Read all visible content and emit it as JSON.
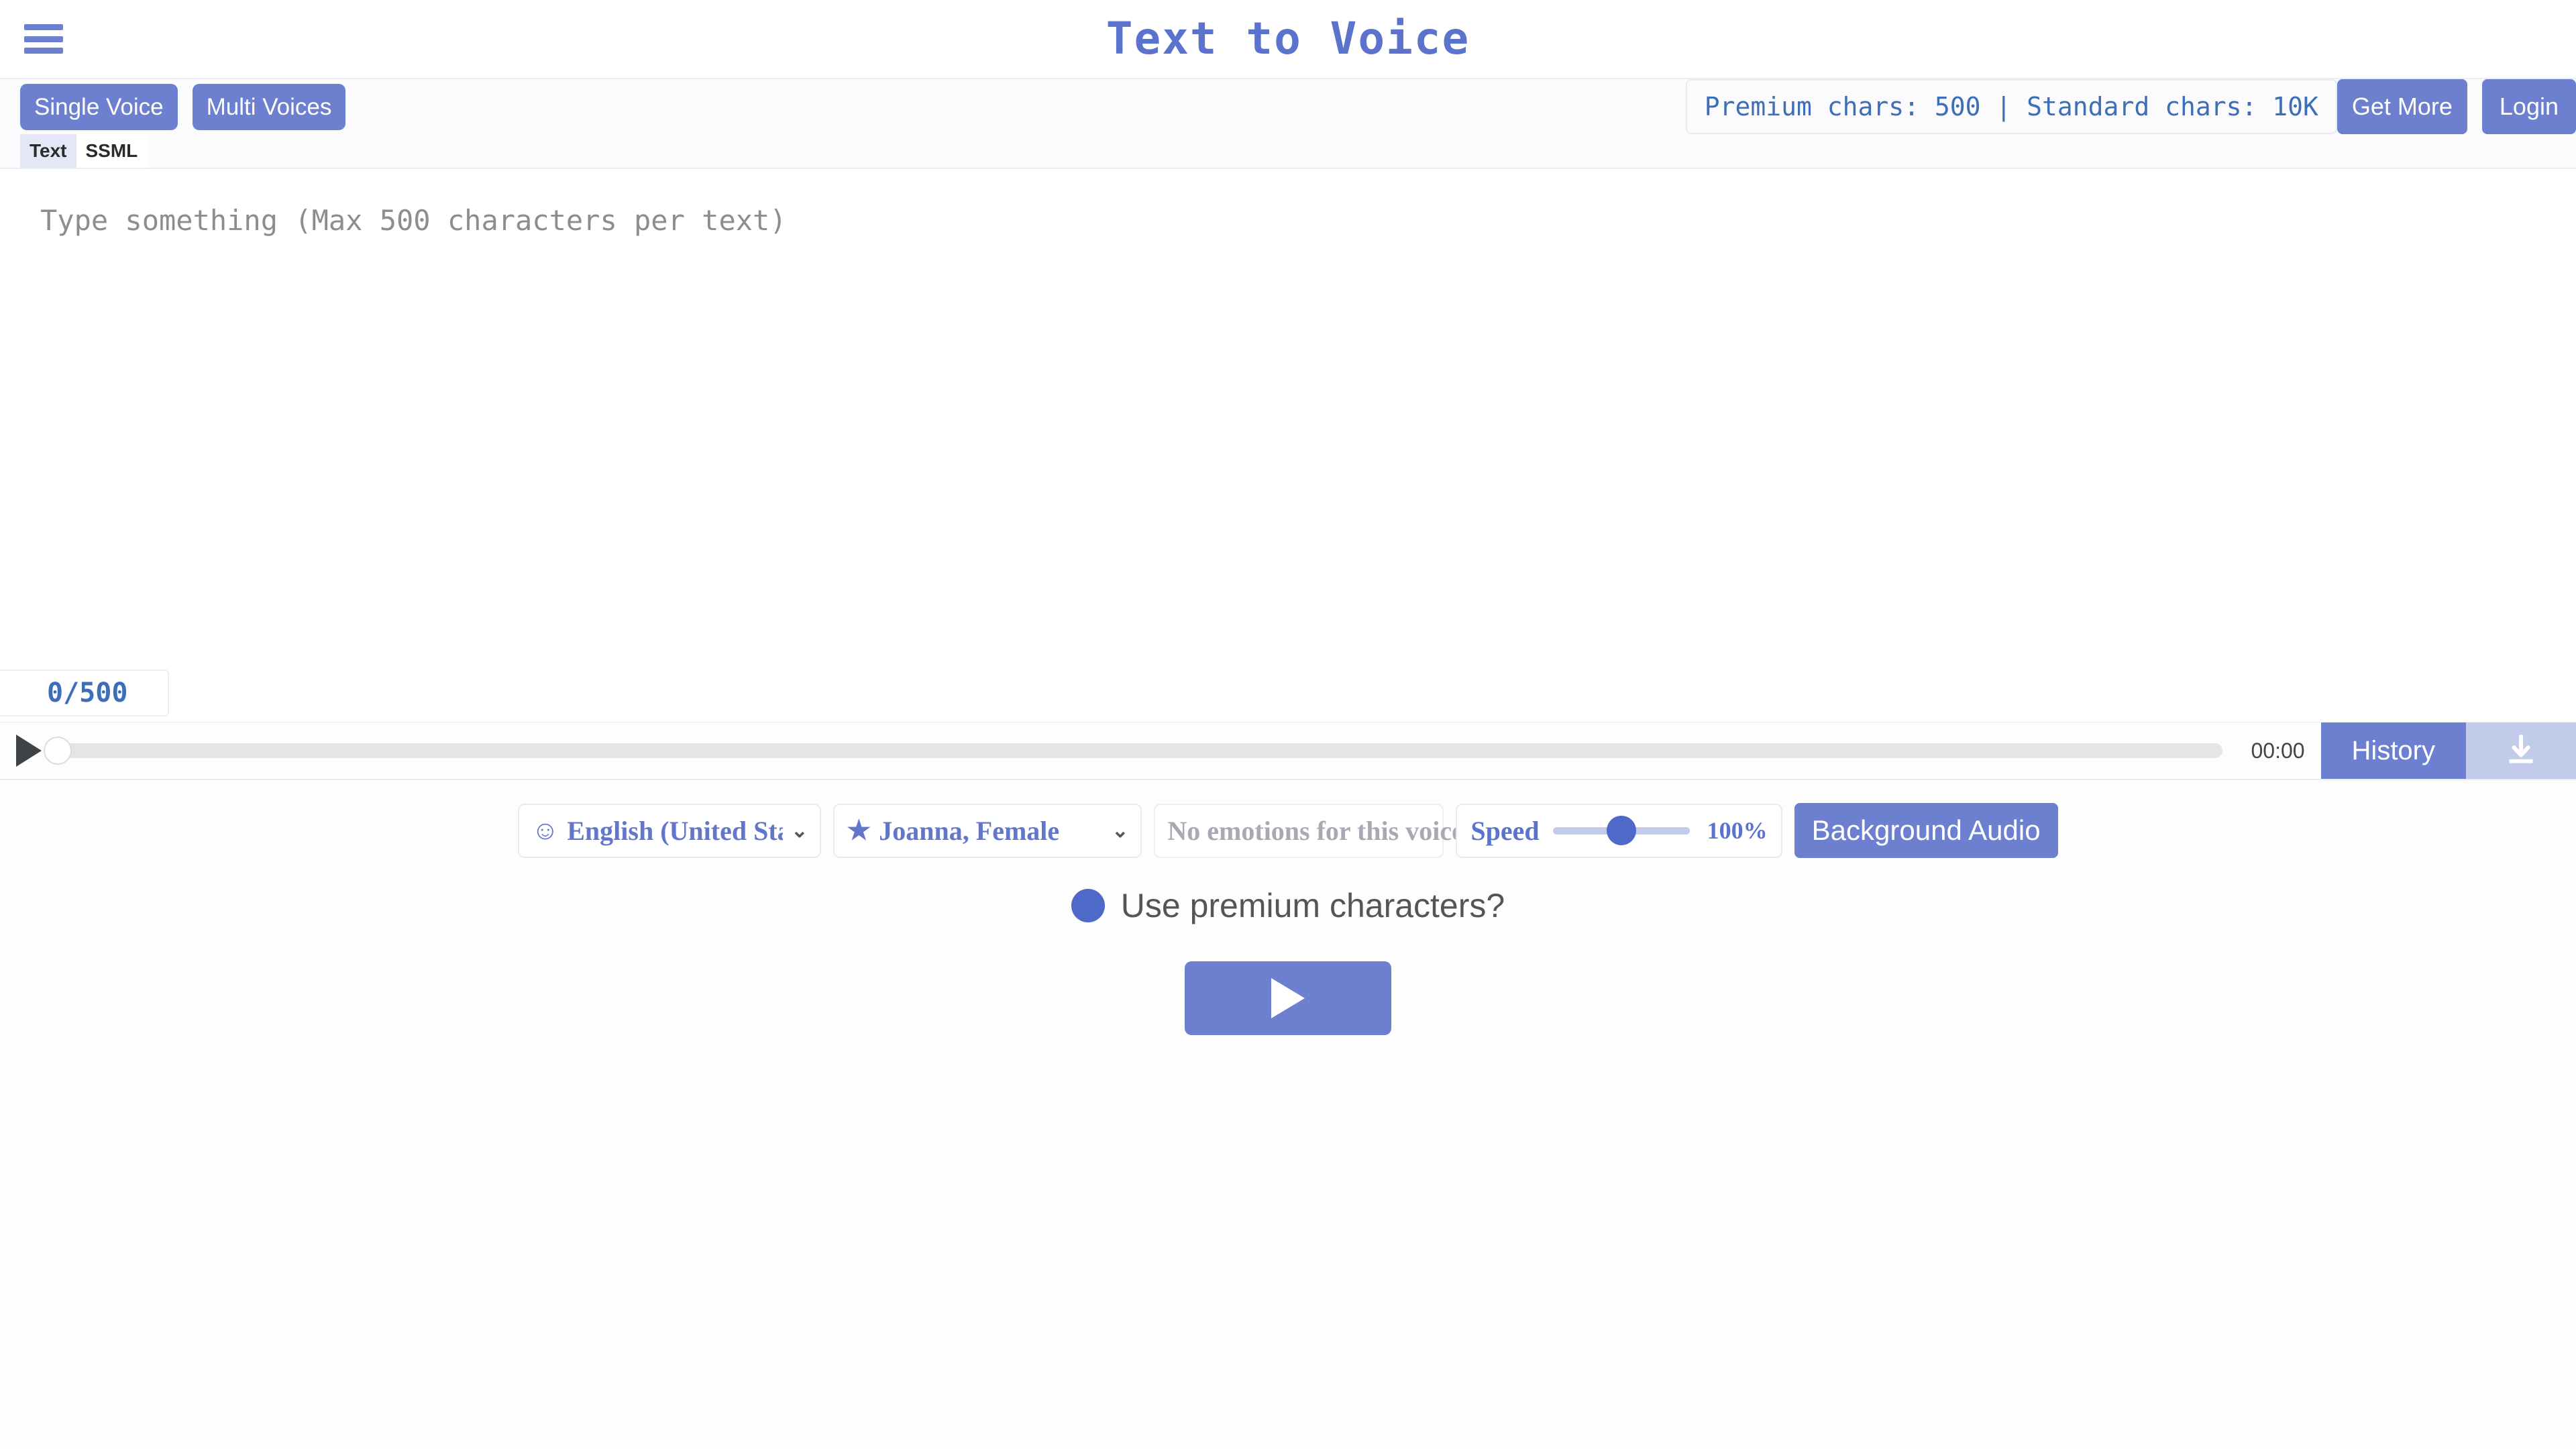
{
  "header": {
    "menu_icon": "hamburger-menu-icon",
    "title": "Text to Voice"
  },
  "actionbar": {
    "single_voice_label": "Single Voice",
    "multi_voices_label": "Multi Voices",
    "credits_text": "Premium chars: 500 | Standard chars: 10K",
    "get_more_label": "Get More",
    "login_label": "Login"
  },
  "tabs": {
    "text_label": "Text",
    "ssml_label": "SSML",
    "active": "Text"
  },
  "editor": {
    "value": "",
    "placeholder": "Type something (Max 500 characters per text)",
    "counter": "0/500"
  },
  "player": {
    "play_icon": "play-icon",
    "seek_position_percent": 0,
    "time": "00:00",
    "history_label": "History",
    "download_icon": "download-icon",
    "download_enabled": false
  },
  "controls": {
    "language": {
      "icon": "smiley-icon",
      "value": "English (United Sta",
      "chevron": "⌄"
    },
    "voice": {
      "icon": "star-icon",
      "value": "Joanna, Female",
      "chevron": "⌄"
    },
    "emotion": {
      "value": "No emotions for this voice",
      "chevron": "⌄",
      "disabled": true
    },
    "speed": {
      "label": "Speed",
      "value": "100%",
      "percent": 100
    },
    "background_audio_label": "Background Audio"
  },
  "premium": {
    "toggle_state": "on",
    "label": "Use premium characters?"
  },
  "generate": {
    "icon": "play-icon"
  },
  "colors": {
    "accent": "#6d80cf",
    "accent_dark": "#4f69c9",
    "accent_muted": "#c3cbeb",
    "title": "#5b73cc",
    "credits_text": "#3c6fb8",
    "tab_active_bg": "#e3e7f6"
  }
}
